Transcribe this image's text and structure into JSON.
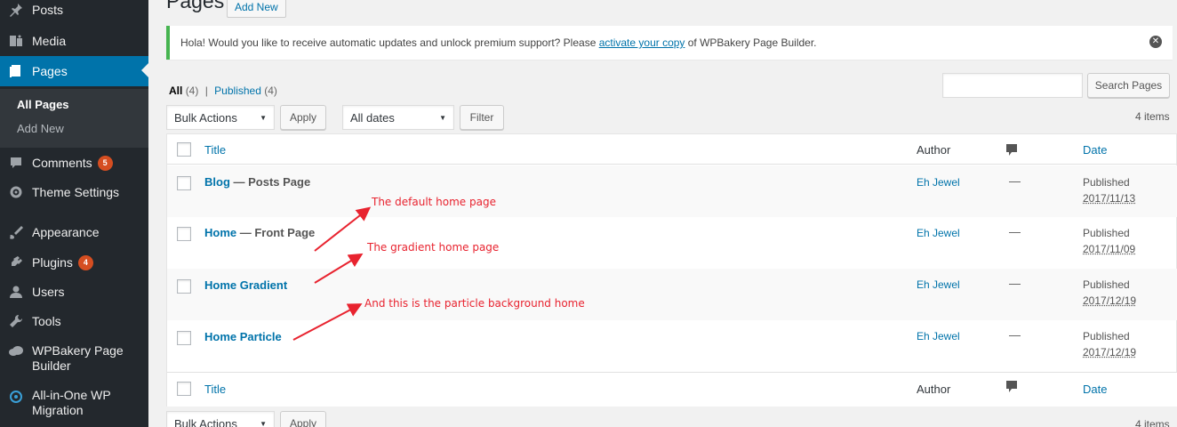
{
  "sidebar": {
    "items": [
      {
        "label": "Posts",
        "icon": "pin-icon"
      },
      {
        "label": "Media",
        "icon": "media-icon"
      },
      {
        "label": "Pages",
        "icon": "pages-icon"
      },
      {
        "label": "Comments",
        "icon": "comments-icon",
        "badge": "5"
      },
      {
        "label": "Theme Settings",
        "icon": "gear-icon"
      },
      {
        "label": "Appearance",
        "icon": "paintbrush-icon"
      },
      {
        "label": "Plugins",
        "icon": "plugin-icon",
        "badge": "4"
      },
      {
        "label": "Users",
        "icon": "users-icon"
      },
      {
        "label": "Tools",
        "icon": "wrench-icon"
      },
      {
        "label": "WPBakery Page Builder",
        "icon": "cloud-icon"
      },
      {
        "label": "All-in-One WP Migration",
        "icon": "migration-icon"
      }
    ],
    "submenu": {
      "all_pages": "All Pages",
      "add_new": "Add New"
    }
  },
  "header": {
    "title": "Pages",
    "add_new": "Add New"
  },
  "notice": {
    "text_before": "Hola! Would you like to receive automatic updates and unlock premium support? Please ",
    "link": "activate your copy",
    "text_after": " of WPBakery Page Builder."
  },
  "views": {
    "all": "All",
    "all_count": "(4)",
    "sep": "|",
    "published": "Published",
    "published_count": "(4)"
  },
  "search": {
    "button": "Search Pages",
    "placeholder": ""
  },
  "tablenav": {
    "bulk_actions": "Bulk Actions",
    "apply": "Apply",
    "dates": "All dates",
    "filter": "Filter",
    "items": "4 items"
  },
  "table": {
    "columns": {
      "title": "Title",
      "author": "Author",
      "date": "Date"
    },
    "rows": [
      {
        "title": "Blog",
        "state": " — Posts Page",
        "author": "Eh Jewel",
        "comments": "—",
        "status": "Published",
        "date": "2017/11/13"
      },
      {
        "title": "Home",
        "state": " — Front Page",
        "author": "Eh Jewel",
        "comments": "—",
        "status": "Published",
        "date": "2017/11/09"
      },
      {
        "title": "Home Gradient",
        "state": "",
        "author": "Eh Jewel",
        "comments": "—",
        "status": "Published",
        "date": "2017/12/19"
      },
      {
        "title": "Home Particle",
        "state": "",
        "author": "Eh Jewel",
        "comments": "—",
        "status": "Published",
        "date": "2017/12/19"
      }
    ]
  },
  "annotations": {
    "a1": "The default home page",
    "a2": "The gradient home page",
    "a3": "And this is the particle background home"
  },
  "colors": {
    "sidebar": "#23282d",
    "accent": "#0073aa",
    "annotation": "#e8232f",
    "notice_border": "#46b450",
    "badge": "#d54e21"
  }
}
